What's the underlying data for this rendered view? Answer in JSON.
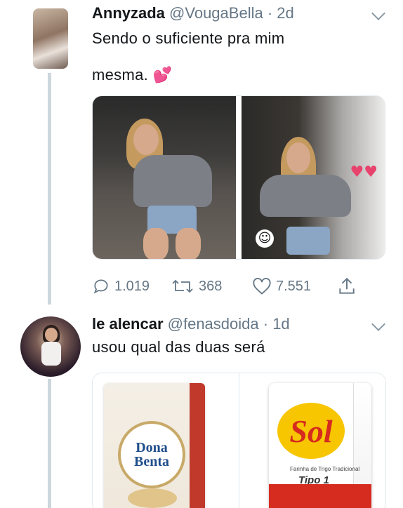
{
  "tweet1": {
    "name": "Annyzada",
    "handle": "@VougaBella",
    "time": "· 2d",
    "text_line1": "Sendo o suficiente pra mim",
    "text_line2": "mesma.",
    "emoji": "💕",
    "stats": {
      "replies": "1.019",
      "retweets": "368",
      "likes": "7.551"
    }
  },
  "tweet2": {
    "name": "le alencar",
    "handle": "@fenasdoida",
    "time": "· 1d",
    "text": "usou qual das duas será"
  },
  "products": {
    "left_brand": "Dona Benta",
    "right_brand": "Sol",
    "right_sub": "Farinha de Trigo Tradicional",
    "right_type": "Tipo 1"
  },
  "icons": {
    "reply": "reply-icon",
    "retweet": "retweet-icon",
    "like": "heart-icon",
    "share": "share-icon",
    "menu": "chevron-down-icon"
  },
  "colors": {
    "secondary": "#657786",
    "thread": "#ccd6dd",
    "accent_heart": "#e7436c"
  }
}
